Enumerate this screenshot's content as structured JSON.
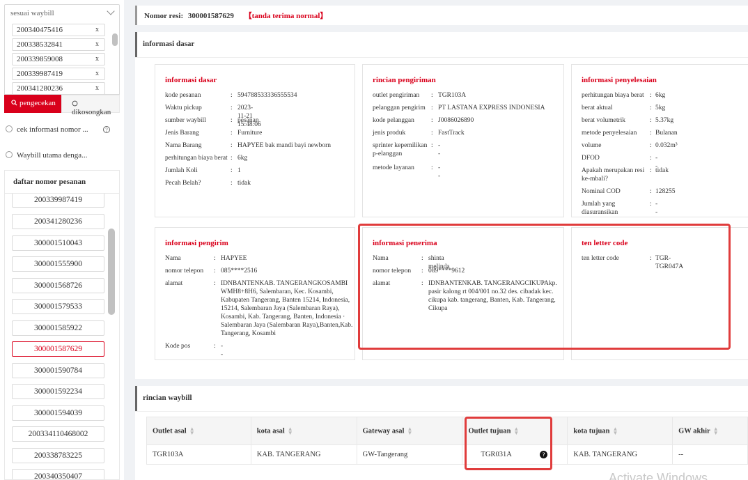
{
  "sidebar": {
    "select_value": "sesuai waybill",
    "chips": [
      "200340475416",
      "200338532841",
      "200339859008",
      "200339987419",
      "200341280236"
    ],
    "chip_remove": "x",
    "check_button": "pengecekan",
    "clear_button": "dikosongkan",
    "radio_options": [
      "cek informasi nomor ...",
      "Waybill utama denga..."
    ],
    "help_glyph": "?",
    "order_list_title": "daftar nomor pesanan",
    "orders": [
      "200339987419",
      "200341280236",
      "300001510043",
      "300001555900",
      "300001568726",
      "300001579533",
      "300001585922",
      "300001587629",
      "300001590784",
      "300001592234",
      "300001594039",
      "200334110468002",
      "200338783225",
      "200340350407"
    ],
    "active_order": "300001587629"
  },
  "header": {
    "resi_label": "Nomor resi:",
    "resi_number": "300001587629",
    "resi_tag": "【tanda terima normal】"
  },
  "basic_section": {
    "title": "informasi dasar",
    "cards": [
      {
        "title": "informasi dasar",
        "rows": [
          {
            "k": "kode pesanan",
            "v": "594788533336555534"
          },
          {
            "k": "Waktu pickup",
            "v": "2023-11-21 15:48:06"
          },
          {
            "k": "sumber waybill",
            "v": "pesanan"
          },
          {
            "k": "Jenis Barang",
            "v": "Furniture"
          },
          {
            "k": "Nama Barang",
            "v": "HAPYEE bak mandi bayi newborn"
          },
          {
            "k": "perhitungan biaya berat",
            "v": "6kg"
          },
          {
            "k": "Jumlah Koli",
            "v": "1"
          },
          {
            "k": "Pecah Belah?",
            "v": "tidak"
          }
        ]
      },
      {
        "title": "rincian pengiriman",
        "rows": [
          {
            "k": "outlet pengiriman",
            "v": "TGR103A"
          },
          {
            "k": "pelanggan pengirim",
            "v": "PT LASTANA EXPRESS INDONESIA"
          },
          {
            "k": "kode pelanggan",
            "v": "J0086026890"
          },
          {
            "k": "jenis produk",
            "v": "FastTrack"
          },
          {
            "k": "sprinter kepemilikan p-elanggan",
            "v": "--"
          },
          {
            "k": "metode layanan",
            "v": "--"
          }
        ]
      },
      {
        "title": "informasi penyelesaian",
        "rows": [
          {
            "k": "perhitungan biaya berat",
            "v": "6kg"
          },
          {
            "k": "berat aktual",
            "v": "5kg"
          },
          {
            "k": "berat volumetrik",
            "v": "5.37kg"
          },
          {
            "k": "metode penyelesaian",
            "v": "Bulanan"
          },
          {
            "k": "volume",
            "v": "0.032m³"
          },
          {
            "k": "DFOD",
            "v": "--"
          },
          {
            "k": "Apakah merupakan resi ke-mbali?",
            "v": "tidak"
          },
          {
            "k": "Nominal COD",
            "v": "128255"
          },
          {
            "k": "Jumlah yang diasuransikan",
            "v": "--"
          }
        ]
      },
      {
        "title": "informasi pengirim",
        "rows": [
          {
            "k": "Nama",
            "v": "HAPYEE"
          },
          {
            "k": "nomor telepon",
            "v": "085****2516"
          },
          {
            "k": "alamat",
            "v": "IDNBANTENKAB. TANGERANGKOSAMBI WMH8+8H6, Salembaran, Kec. Kosambi, Kabupaten Tangerang, Banten 15214, Indonesia, 15214, Salembaran Jaya (Salembaran Raya), Kosambi, Kab. Tangerang, Banten, Indonesia · Salembaran Jaya (Salembaran Raya),Banten,Kab. Tangerang, Kosambi"
          },
          {
            "k": "Kode pos",
            "v": "--"
          }
        ]
      },
      {
        "title": "informasi penerima",
        "rows": [
          {
            "k": "Nama",
            "v": "shinta melinda"
          },
          {
            "k": "nomor telepon",
            "v": "089****9612"
          },
          {
            "k": "alamat",
            "v": "IDNBANTENKAB. TANGERANGCIKUPAkp. pasir kalong rt 004/001 no.32 des. cibadak kec. cikupa kab. tangerang, Banten, Kab. Tangerang, Cikupa"
          }
        ]
      },
      {
        "title": "ten letter code",
        "rows": [
          {
            "k": "ten letter code",
            "v": "TGR-TGR047A"
          }
        ]
      }
    ]
  },
  "waybill_section": {
    "title": "rincian waybill",
    "columns": [
      "Outlet asal",
      "kota asal",
      "Gateway asal",
      "Outlet tujuan",
      "kota tujuan",
      "GW akhir"
    ],
    "rows": [
      [
        "TGR103A",
        "KAB. TANGERANG",
        "GW-Tangerang",
        "TGR031A",
        "KAB. TANGERANG",
        "--"
      ]
    ],
    "help_glyph": "?"
  },
  "overlay_text": "Activate Windows"
}
